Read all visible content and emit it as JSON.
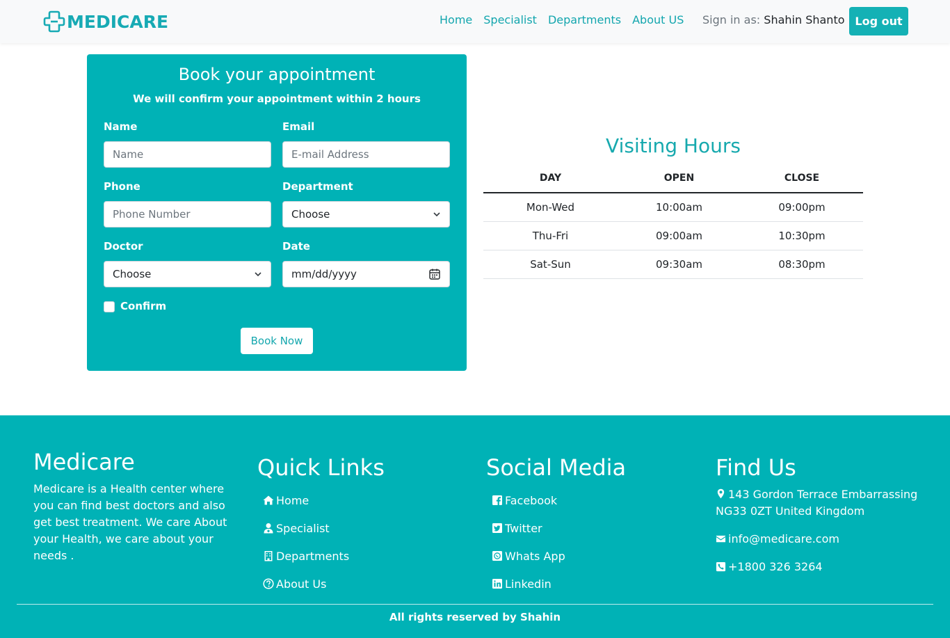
{
  "navbar": {
    "brand": "MEDICARE",
    "links": [
      "Home",
      "Specialist",
      "Departments",
      "About US"
    ],
    "signin_prefix": "Sign in as:",
    "user_name": "Shahin Shanto",
    "logout_label": "Log out"
  },
  "booking": {
    "title": "Book your appointment",
    "subtitle": "We will confirm your appointment within 2 hours",
    "name_label": "Name",
    "name_placeholder": "Name",
    "email_label": "Email",
    "email_placeholder": "E-mail Address",
    "phone_label": "Phone",
    "phone_placeholder": "Phone Number",
    "department_label": "Department",
    "department_value": "Choose",
    "doctor_label": "Doctor",
    "doctor_value": "Choose",
    "date_label": "Date",
    "date_placeholder": "mm/dd/yyyy",
    "confirm_label": "Confirm",
    "confirm_checked": false,
    "submit_label": "Book Now"
  },
  "visiting_hours": {
    "title": "Visiting Hours",
    "headers": [
      "DAY",
      "OPEN",
      "CLOSE"
    ],
    "rows": [
      [
        "Mon-Wed",
        "10:00am",
        "09:00pm"
      ],
      [
        "Thu-Fri",
        "09:00am",
        "10:30pm"
      ],
      [
        "Sat-Sun",
        "09:30am",
        "08:30pm"
      ]
    ]
  },
  "footer": {
    "brand": "Medicare",
    "about": "Medicare is a Health center where you can find best doctors and also get best treatment. We care About your Health, we care about your needs .",
    "quick_links_title": "Quick Links",
    "quick_links": [
      {
        "label": "Home",
        "icon": "home-icon"
      },
      {
        "label": "Specialist",
        "icon": "user-doctor-icon"
      },
      {
        "label": "Departments",
        "icon": "building-icon"
      },
      {
        "label": "About Us",
        "icon": "question-circle-icon"
      }
    ],
    "social_title": "Social Media",
    "social_links": [
      {
        "label": "Facebook",
        "icon": "facebook-icon"
      },
      {
        "label": "Twitter",
        "icon": "twitter-icon"
      },
      {
        "label": "Whats App",
        "icon": "whatsapp-icon"
      },
      {
        "label": "Linkedin",
        "icon": "linkedin-icon"
      }
    ],
    "find_title": "Find Us",
    "address": "143 Gordon Terrace Embarrassing NG33 0ZT United Kingdom",
    "email": "info@medicare.com",
    "phone": "+1800 326 3264",
    "copyright": "All rights reserved by Shahin"
  },
  "colors": {
    "brand": "#00b2b6",
    "nav_link": "#13a6ae",
    "navbar_bg": "#f8f9fa"
  }
}
